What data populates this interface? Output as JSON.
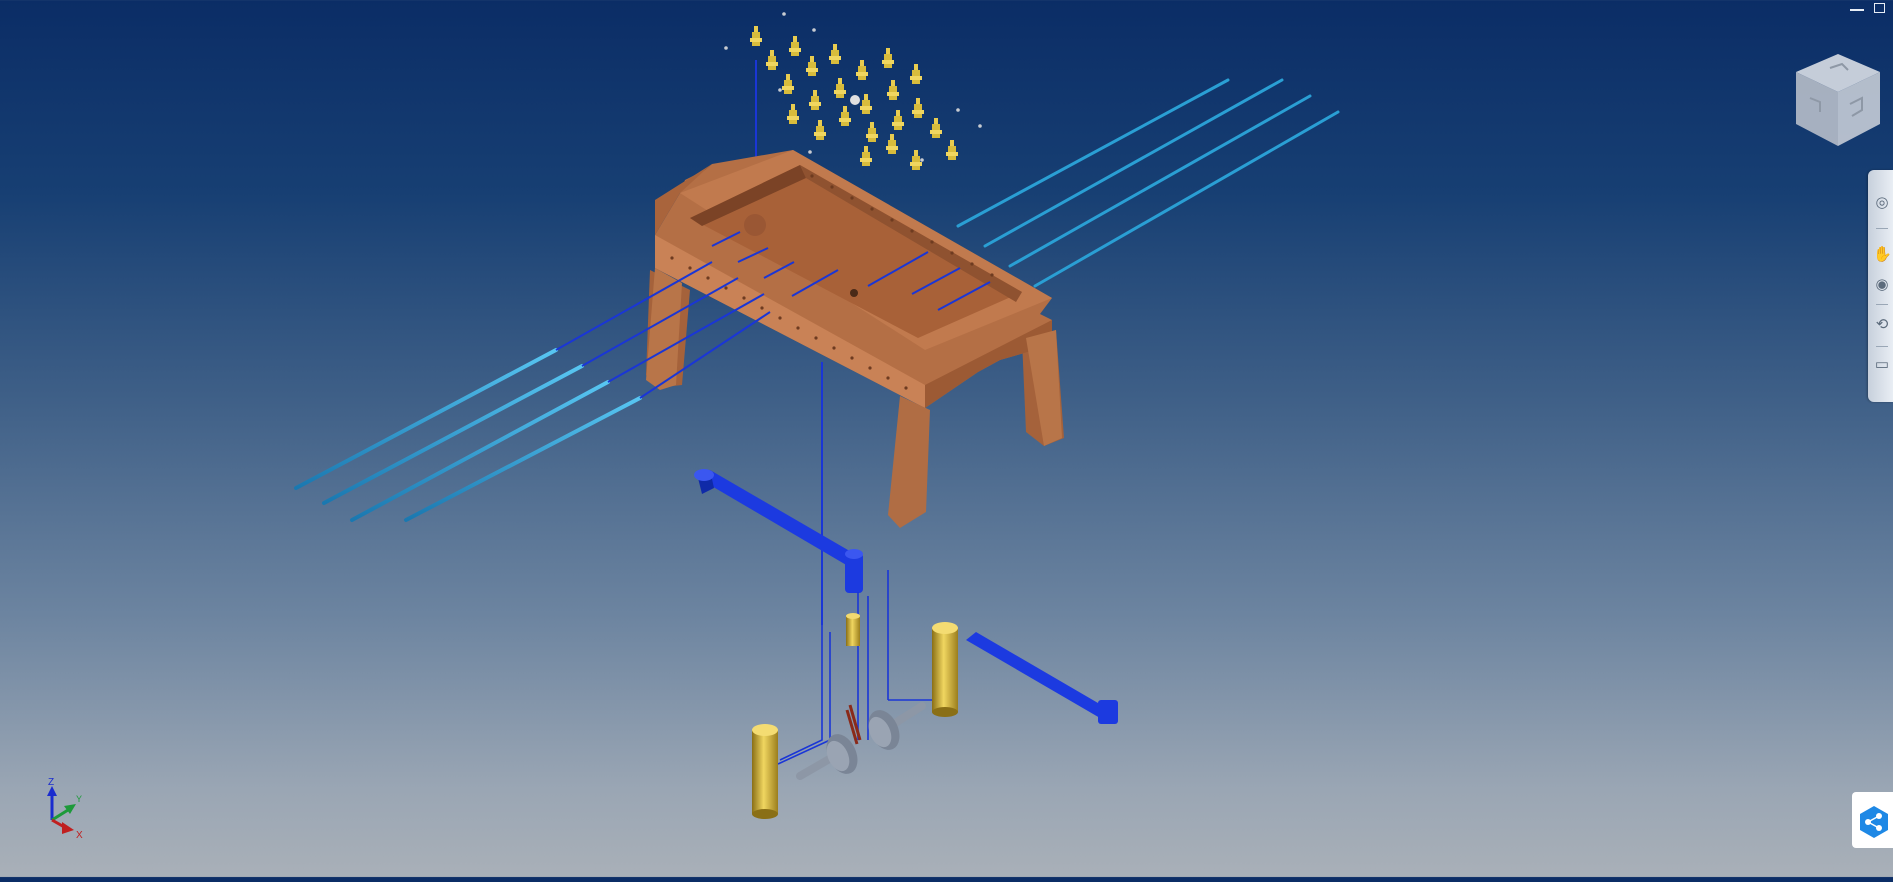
{
  "window_controls": {
    "minimize_icon": "minimize-icon",
    "maximize_icon": "restore-icon"
  },
  "viewcube": {
    "icon": "view-cube-icon"
  },
  "navigation_bar": {
    "items": [
      {
        "name": "steering-wheel",
        "icon": "steering-wheel-icon"
      },
      {
        "name": "pan",
        "icon": "hand-pan-icon"
      },
      {
        "name": "zoom",
        "icon": "zoom-icon"
      },
      {
        "name": "orbit",
        "icon": "orbit-icon"
      },
      {
        "name": "look-at",
        "icon": "look-at-icon"
      }
    ]
  },
  "share": {
    "icon": "share-icon",
    "color": "#1e88e5"
  },
  "triad": {
    "z_label": "Z",
    "y_label": "Y",
    "x_label": "X"
  },
  "colors": {
    "wood": "#b46f45",
    "wood_dark": "#8c5230",
    "rod": "#2a9fd4",
    "constraint_line": "#1a36d6",
    "blue_part": "#1c3ae0",
    "brass": "#d2b43a",
    "steel": "#8d97a6"
  }
}
